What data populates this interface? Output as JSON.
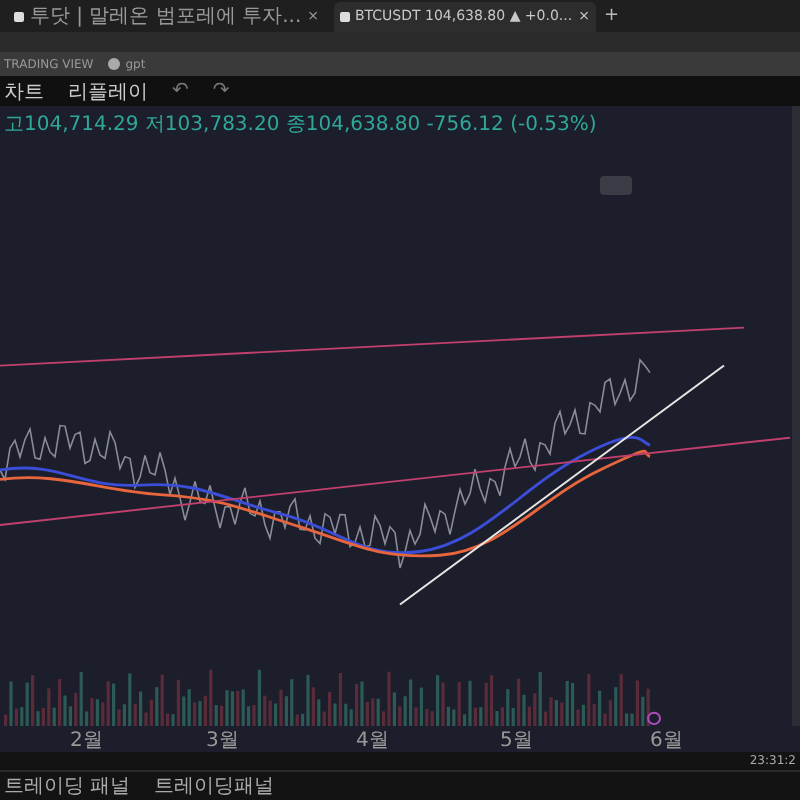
{
  "tabs": [
    {
      "label": "투닷 | 말레온 범포레에 투자...",
      "selected": false,
      "close": "×"
    },
    {
      "label": "BTCUSDT 104,638.80 ▲ +0.0...",
      "selected": true,
      "close": "×"
    }
  ],
  "new_tab": "+",
  "bookmarks": [
    {
      "label": "TRADING VIEW"
    },
    {
      "label": "gpt"
    }
  ],
  "toolbar": {
    "chart_label": "차트",
    "replay": "리플레이",
    "undo": "↶",
    "redo": "↷"
  },
  "legend": "고104,714.29 저103,783.20 종104,638.80 -756.12 (-0.53%)",
  "time_axis": {
    "months": [
      "2월",
      "3월",
      "4월",
      "5월",
      "6월"
    ],
    "clock": "23:31:2"
  },
  "bottom_panel": [
    "트레이딩 패널",
    "트레이딩패널"
  ]
}
